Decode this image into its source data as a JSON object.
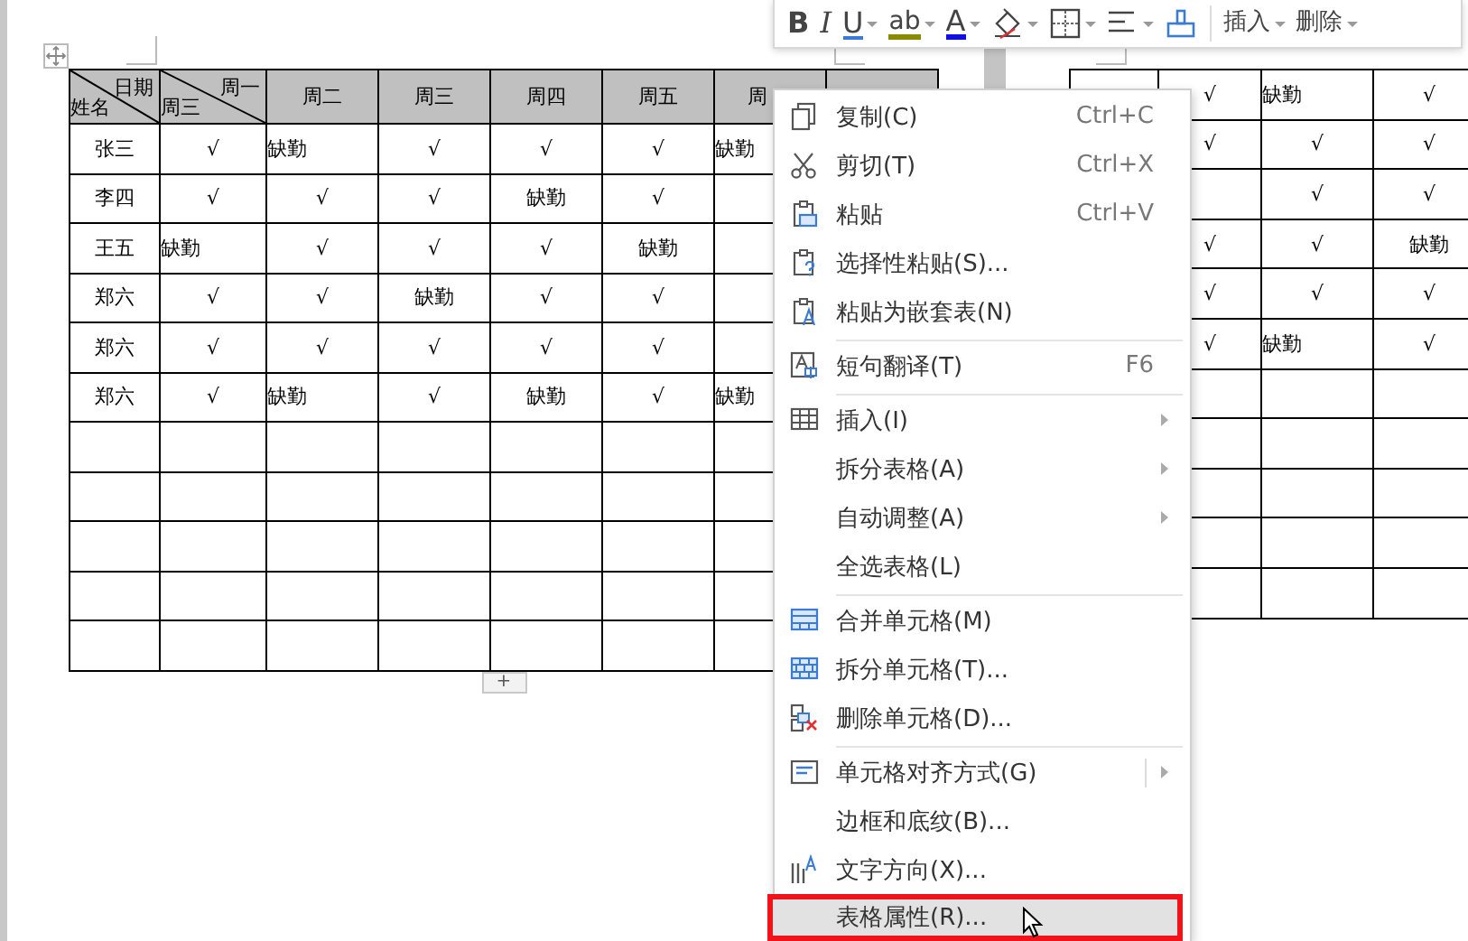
{
  "toolbar": {
    "items": [
      {
        "kind": "bold",
        "label": "B",
        "dropdown": false
      },
      {
        "kind": "italic",
        "label": "I",
        "dropdown": false
      },
      {
        "kind": "underline",
        "label": "U",
        "dropdown": true
      },
      {
        "kind": "highlight",
        "label": "ab",
        "dropdown": true
      },
      {
        "kind": "font-color",
        "label": "A",
        "dropdown": true
      },
      {
        "kind": "shading",
        "dropdown": true
      },
      {
        "kind": "borders",
        "dropdown": true
      },
      {
        "kind": "align",
        "dropdown": true
      },
      {
        "kind": "format-painter",
        "dropdown": false
      },
      {
        "kind": "separator"
      },
      {
        "kind": "text",
        "label": "插入",
        "dropdown": true
      },
      {
        "kind": "text",
        "label": "删除",
        "dropdown": true
      }
    ]
  },
  "left_table": {
    "header": [
      {
        "kind": "diagonal",
        "top": "日期",
        "bottom": "姓名"
      },
      {
        "kind": "diagonal",
        "top": "周一",
        "bottom": "周三"
      },
      {
        "kind": "plain",
        "label": "周二"
      },
      {
        "kind": "plain",
        "label": "周三"
      },
      {
        "kind": "plain",
        "label": "周四"
      },
      {
        "kind": "plain",
        "label": "周五"
      },
      {
        "kind": "plain",
        "label": "周"
      },
      {
        "kind": "plain"
      }
    ],
    "rows": [
      {
        "cells": [
          {
            "text": "张三",
            "left_aligned": false
          },
          {
            "text": "√",
            "left_aligned": false
          },
          {
            "text": "缺勤",
            "left_aligned": true
          },
          {
            "text": "√",
            "left_aligned": false
          },
          {
            "text": "√",
            "left_aligned": false
          },
          {
            "text": "√",
            "left_aligned": false
          },
          {
            "text": "缺勤",
            "left_aligned": true
          },
          null
        ]
      },
      {
        "cells": [
          {
            "text": "李四",
            "left_aligned": false
          },
          {
            "text": "√",
            "left_aligned": false
          },
          {
            "text": "√",
            "left_aligned": false
          },
          {
            "text": "√",
            "left_aligned": false
          },
          {
            "text": "缺勤",
            "left_aligned": false
          },
          {
            "text": "√",
            "left_aligned": false
          },
          null,
          null
        ]
      },
      {
        "cells": [
          {
            "text": "王五",
            "left_aligned": false
          },
          {
            "text": "缺勤",
            "left_aligned": true
          },
          {
            "text": "√",
            "left_aligned": false
          },
          {
            "text": "√",
            "left_aligned": false
          },
          {
            "text": "√",
            "left_aligned": false
          },
          {
            "text": "缺勤",
            "left_aligned": false
          },
          null,
          null
        ]
      },
      {
        "cells": [
          {
            "text": "郑六",
            "left_aligned": false
          },
          {
            "text": "√",
            "left_aligned": false
          },
          {
            "text": "√",
            "left_aligned": false
          },
          {
            "text": "缺勤",
            "left_aligned": false
          },
          {
            "text": "√",
            "left_aligned": false
          },
          {
            "text": "√",
            "left_aligned": false
          },
          null,
          null
        ]
      },
      {
        "cells": [
          {
            "text": "郑六",
            "left_aligned": false
          },
          {
            "text": "√",
            "left_aligned": false
          },
          {
            "text": "√",
            "left_aligned": false
          },
          {
            "text": "√",
            "left_aligned": false
          },
          {
            "text": "√",
            "left_aligned": false
          },
          {
            "text": "√",
            "left_aligned": false
          },
          null,
          null
        ]
      },
      {
        "cells": [
          {
            "text": "郑六",
            "left_aligned": false
          },
          {
            "text": "√",
            "left_aligned": false
          },
          {
            "text": "缺勤",
            "left_aligned": true
          },
          {
            "text": "√",
            "left_aligned": false
          },
          {
            "text": "缺勤",
            "left_aligned": false
          },
          {
            "text": "√",
            "left_aligned": false
          },
          {
            "text": "缺勤",
            "left_aligned": true
          },
          null
        ]
      },
      {
        "cells": [
          null,
          null,
          null,
          null,
          null,
          null,
          null,
          null
        ]
      },
      {
        "cells": [
          null,
          null,
          null,
          null,
          null,
          null,
          null,
          null
        ]
      },
      {
        "cells": [
          null,
          null,
          null,
          null,
          null,
          null,
          null,
          null
        ]
      },
      {
        "cells": [
          null,
          null,
          null,
          null,
          null,
          null,
          null,
          null
        ]
      },
      {
        "cells": [
          null,
          null,
          null,
          null,
          null,
          null,
          null,
          null
        ]
      }
    ]
  },
  "add_row_button": {
    "label": "+"
  },
  "right_table": {
    "rows": [
      {
        "cells": [
          null,
          {
            "text": "√",
            "left_aligned": false
          },
          {
            "text": "缺勤",
            "left_aligned": true
          },
          {
            "text": "√",
            "left_aligned": false
          }
        ]
      },
      {
        "cells": [
          null,
          {
            "text": "√",
            "left_aligned": false
          },
          {
            "text": "√",
            "left_aligned": false
          },
          {
            "text": "√",
            "left_aligned": false
          }
        ]
      },
      {
        "cells": [
          null,
          null,
          {
            "text": "√",
            "left_aligned": false
          },
          {
            "text": "√",
            "left_aligned": false
          }
        ]
      },
      {
        "cells": [
          null,
          {
            "text": "√",
            "left_aligned": false
          },
          {
            "text": "√",
            "left_aligned": false
          },
          {
            "text": "缺勤",
            "left_aligned": false
          }
        ]
      },
      {
        "cells": [
          null,
          {
            "text": "√",
            "left_aligned": false
          },
          {
            "text": "√",
            "left_aligned": false
          },
          {
            "text": "√",
            "left_aligned": false
          }
        ]
      },
      {
        "cells": [
          null,
          {
            "text": "√",
            "left_aligned": false
          },
          {
            "text": "缺勤",
            "left_aligned": true
          },
          {
            "text": "√",
            "left_aligned": false
          }
        ]
      },
      {
        "cells": [
          null,
          null,
          null,
          null
        ]
      },
      {
        "cells": [
          null,
          null,
          null,
          null
        ]
      },
      {
        "cells": [
          null,
          null,
          null,
          null
        ]
      },
      {
        "cells": [
          null,
          null,
          null,
          null
        ]
      },
      {
        "cells": [
          null,
          null,
          null,
          null
        ]
      }
    ]
  },
  "context_menu": {
    "items": [
      {
        "kind": "copy",
        "label": "复制(C)",
        "shortcut": "Ctrl+C",
        "submenu": false,
        "split": false,
        "selected": false,
        "outlined": false
      },
      {
        "kind": "cut",
        "label": "剪切(T)",
        "shortcut": "Ctrl+X",
        "submenu": false,
        "split": false,
        "selected": false,
        "outlined": false
      },
      {
        "kind": "paste",
        "label": "粘贴",
        "shortcut": "Ctrl+V",
        "submenu": false,
        "split": false,
        "selected": false,
        "outlined": false
      },
      {
        "kind": "paste-special",
        "label": "选择性粘贴(S)...",
        "submenu": false,
        "split": false,
        "selected": false,
        "outlined": false
      },
      {
        "kind": "paste-nested",
        "label": "粘贴为嵌套表(N)",
        "submenu": false,
        "split": false,
        "selected": false,
        "outlined": false
      },
      {
        "kind": "separator"
      },
      {
        "kind": "translate",
        "label": "短句翻译(T)",
        "shortcut": "F6",
        "submenu": false,
        "split": false,
        "selected": false,
        "outlined": false
      },
      {
        "kind": "separator"
      },
      {
        "kind": "insert",
        "label": "插入(I)",
        "submenu": true,
        "split": false,
        "selected": false,
        "outlined": false
      },
      {
        "kind": "plain",
        "label": "拆分表格(A)",
        "submenu": true,
        "split": false,
        "selected": false,
        "outlined": false
      },
      {
        "kind": "plain",
        "label": "自动调整(A)",
        "submenu": true,
        "split": false,
        "selected": false,
        "outlined": false
      },
      {
        "kind": "plain",
        "label": "全选表格(L)",
        "submenu": false,
        "split": false,
        "selected": false,
        "outlined": false
      },
      {
        "kind": "separator"
      },
      {
        "kind": "merge",
        "label": "合并单元格(M)",
        "submenu": false,
        "split": false,
        "selected": false,
        "outlined": false
      },
      {
        "kind": "split",
        "label": "拆分单元格(T)...",
        "submenu": false,
        "split": false,
        "selected": false,
        "outlined": false
      },
      {
        "kind": "delete",
        "label": "删除单元格(D)...",
        "submenu": false,
        "split": false,
        "selected": false,
        "outlined": false
      },
      {
        "kind": "separator"
      },
      {
        "kind": "cell-align",
        "label": "单元格对齐方式(G)",
        "submenu": true,
        "split": true,
        "selected": false,
        "outlined": false
      },
      {
        "kind": "plain",
        "label": "边框和底纹(B)...",
        "submenu": false,
        "split": false,
        "selected": false,
        "outlined": false
      },
      {
        "kind": "text-direction",
        "label": "文字方向(X)...",
        "submenu": false,
        "split": false,
        "selected": false,
        "outlined": false
      },
      {
        "kind": "plain",
        "label": "表格属性(R)...",
        "submenu": false,
        "split": false,
        "selected": true,
        "outlined": true
      }
    ]
  }
}
